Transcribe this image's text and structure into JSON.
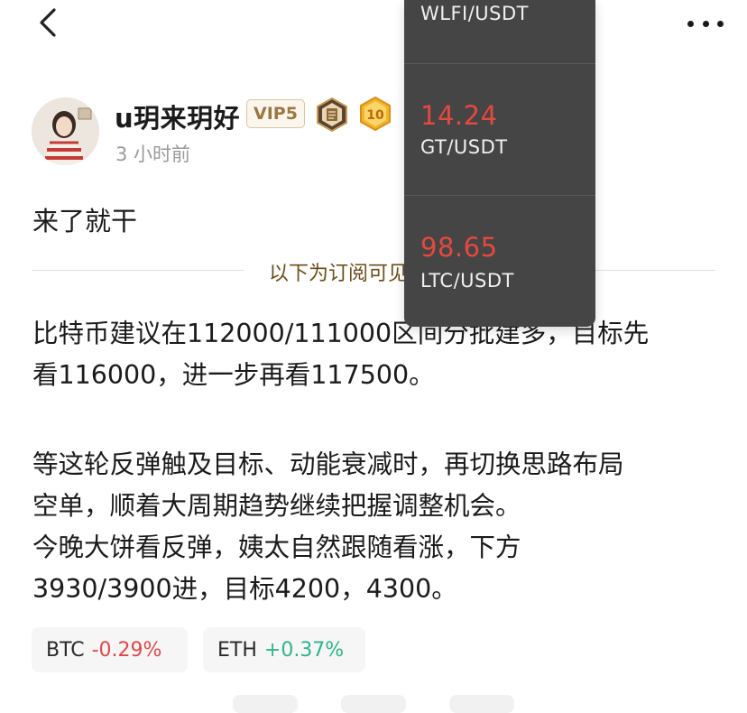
{
  "header": {
    "back_icon": "chevron-left-icon",
    "more_icon": "more-dots-icon"
  },
  "author": {
    "name": "u玥来玥好",
    "vip_label": "VIP5",
    "level_badge": "10",
    "posted_ago": "3 小时前"
  },
  "post": {
    "title": "来了就干",
    "subscriber_divider": "以下为订阅可见内容",
    "paragraphs": [
      "比特币建议在112000/111000区间分批建多，目标先",
      "看116000，进一步再看117500。",
      "等这轮反弹触及目标、动能衰减时，再切换思路布局",
      "空单，顺着大周期趋势继续把握调整机会。",
      "今晚大饼看反弹，姨太自然跟随看涨，下方",
      "3930/3900进，目标4200，4300。"
    ]
  },
  "coin_tags": [
    {
      "symbol": "BTC",
      "change": "-0.29%"
    },
    {
      "symbol": "ETH",
      "change": "+0.37%"
    }
  ],
  "ticker_dropdown": [
    {
      "price": "",
      "pair": "WLFI/USDT"
    },
    {
      "price": "14.24",
      "pair": "GT/USDT"
    },
    {
      "price": "98.65",
      "pair": "LTC/USDT"
    }
  ],
  "colors": {
    "negative": "#e0484a",
    "positive": "#2fb48b",
    "dropdown_bg": "#454545",
    "divider_label": "#6b4e1c"
  }
}
